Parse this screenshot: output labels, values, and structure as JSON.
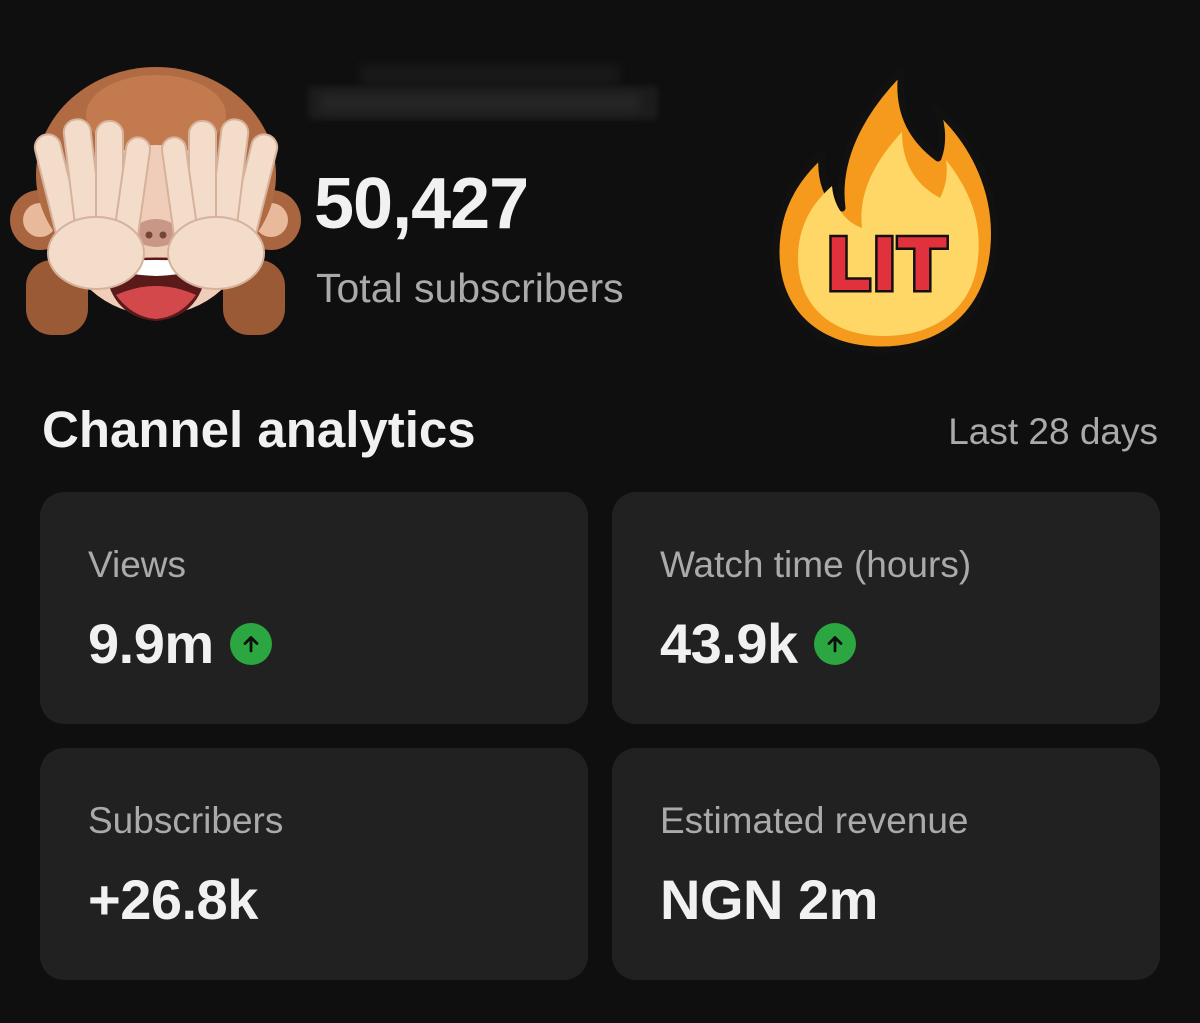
{
  "header": {
    "subscriber_count": "50,427",
    "subscriber_label": "Total subscribers",
    "stickers": {
      "left": "see-no-evil-monkey-icon",
      "right": "lit-fire-icon",
      "fire_text": "LIT"
    }
  },
  "analytics": {
    "title": "Channel analytics",
    "period": "Last 28 days",
    "cards": [
      {
        "label": "Views",
        "value": "9.9m",
        "trend": "up"
      },
      {
        "label": "Watch time (hours)",
        "value": "43.9k",
        "trend": "up"
      },
      {
        "label": "Subscribers",
        "value": "+26.8k",
        "trend": "none"
      },
      {
        "label": "Estimated revenue",
        "value": "NGN 2m",
        "trend": "none"
      }
    ]
  },
  "colors": {
    "background": "#0f0f0f",
    "card": "#212121",
    "text_primary": "#f1f1f1",
    "text_secondary": "#aaaaaa",
    "trend_up": "#2ba640",
    "fire_text": "#e0313c"
  }
}
